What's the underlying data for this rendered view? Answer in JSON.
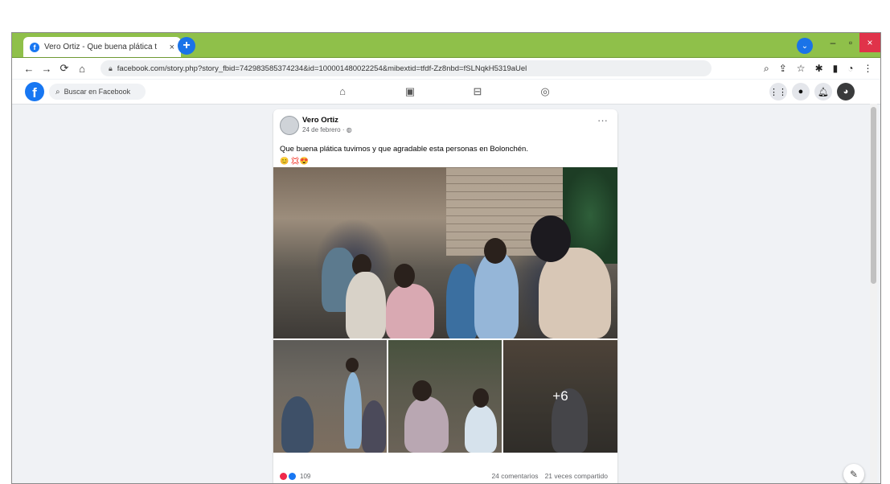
{
  "browser": {
    "tab_title": "Vero Ortiz - Que buena plática t",
    "tab_close": "×",
    "new_tab": "+",
    "url": "facebook.com/story.php?story_fbid=742983585374234&id=100001480022254&mibextid=tfdf-Zz8nbd=fSLNqkH5319aUel",
    "nav": {
      "back": "←",
      "forward": "→",
      "reload": "⟳",
      "home": "⌂"
    },
    "window_controls": {
      "minimize": "–",
      "maximize": "▫",
      "close": "×"
    }
  },
  "facebook": {
    "logo": "f",
    "search_placeholder": "Buscar en Facebook",
    "nav_icons": [
      "home-icon",
      "watch-icon",
      "marketplace-icon",
      "groups-icon"
    ],
    "right_icons": [
      "menu-icon",
      "messenger-icon",
      "notifications-icon",
      "account-icon"
    ]
  },
  "post": {
    "author": "Vero Ortiz",
    "date": "24 de febrero · ◍",
    "more": "···",
    "text": "Que buena plática tuvimos y que agradable esta personas en Bolonchén.",
    "emojis": "😊 💢😍",
    "extra_photos": "+6",
    "reaction_count": "109",
    "comments": "24 comentarios",
    "shares": "21 veces compartido"
  },
  "colors": {
    "tabstrip": "#8fc04a",
    "facebook_blue": "#1877f2",
    "page_bg": "#f0f2f5"
  }
}
